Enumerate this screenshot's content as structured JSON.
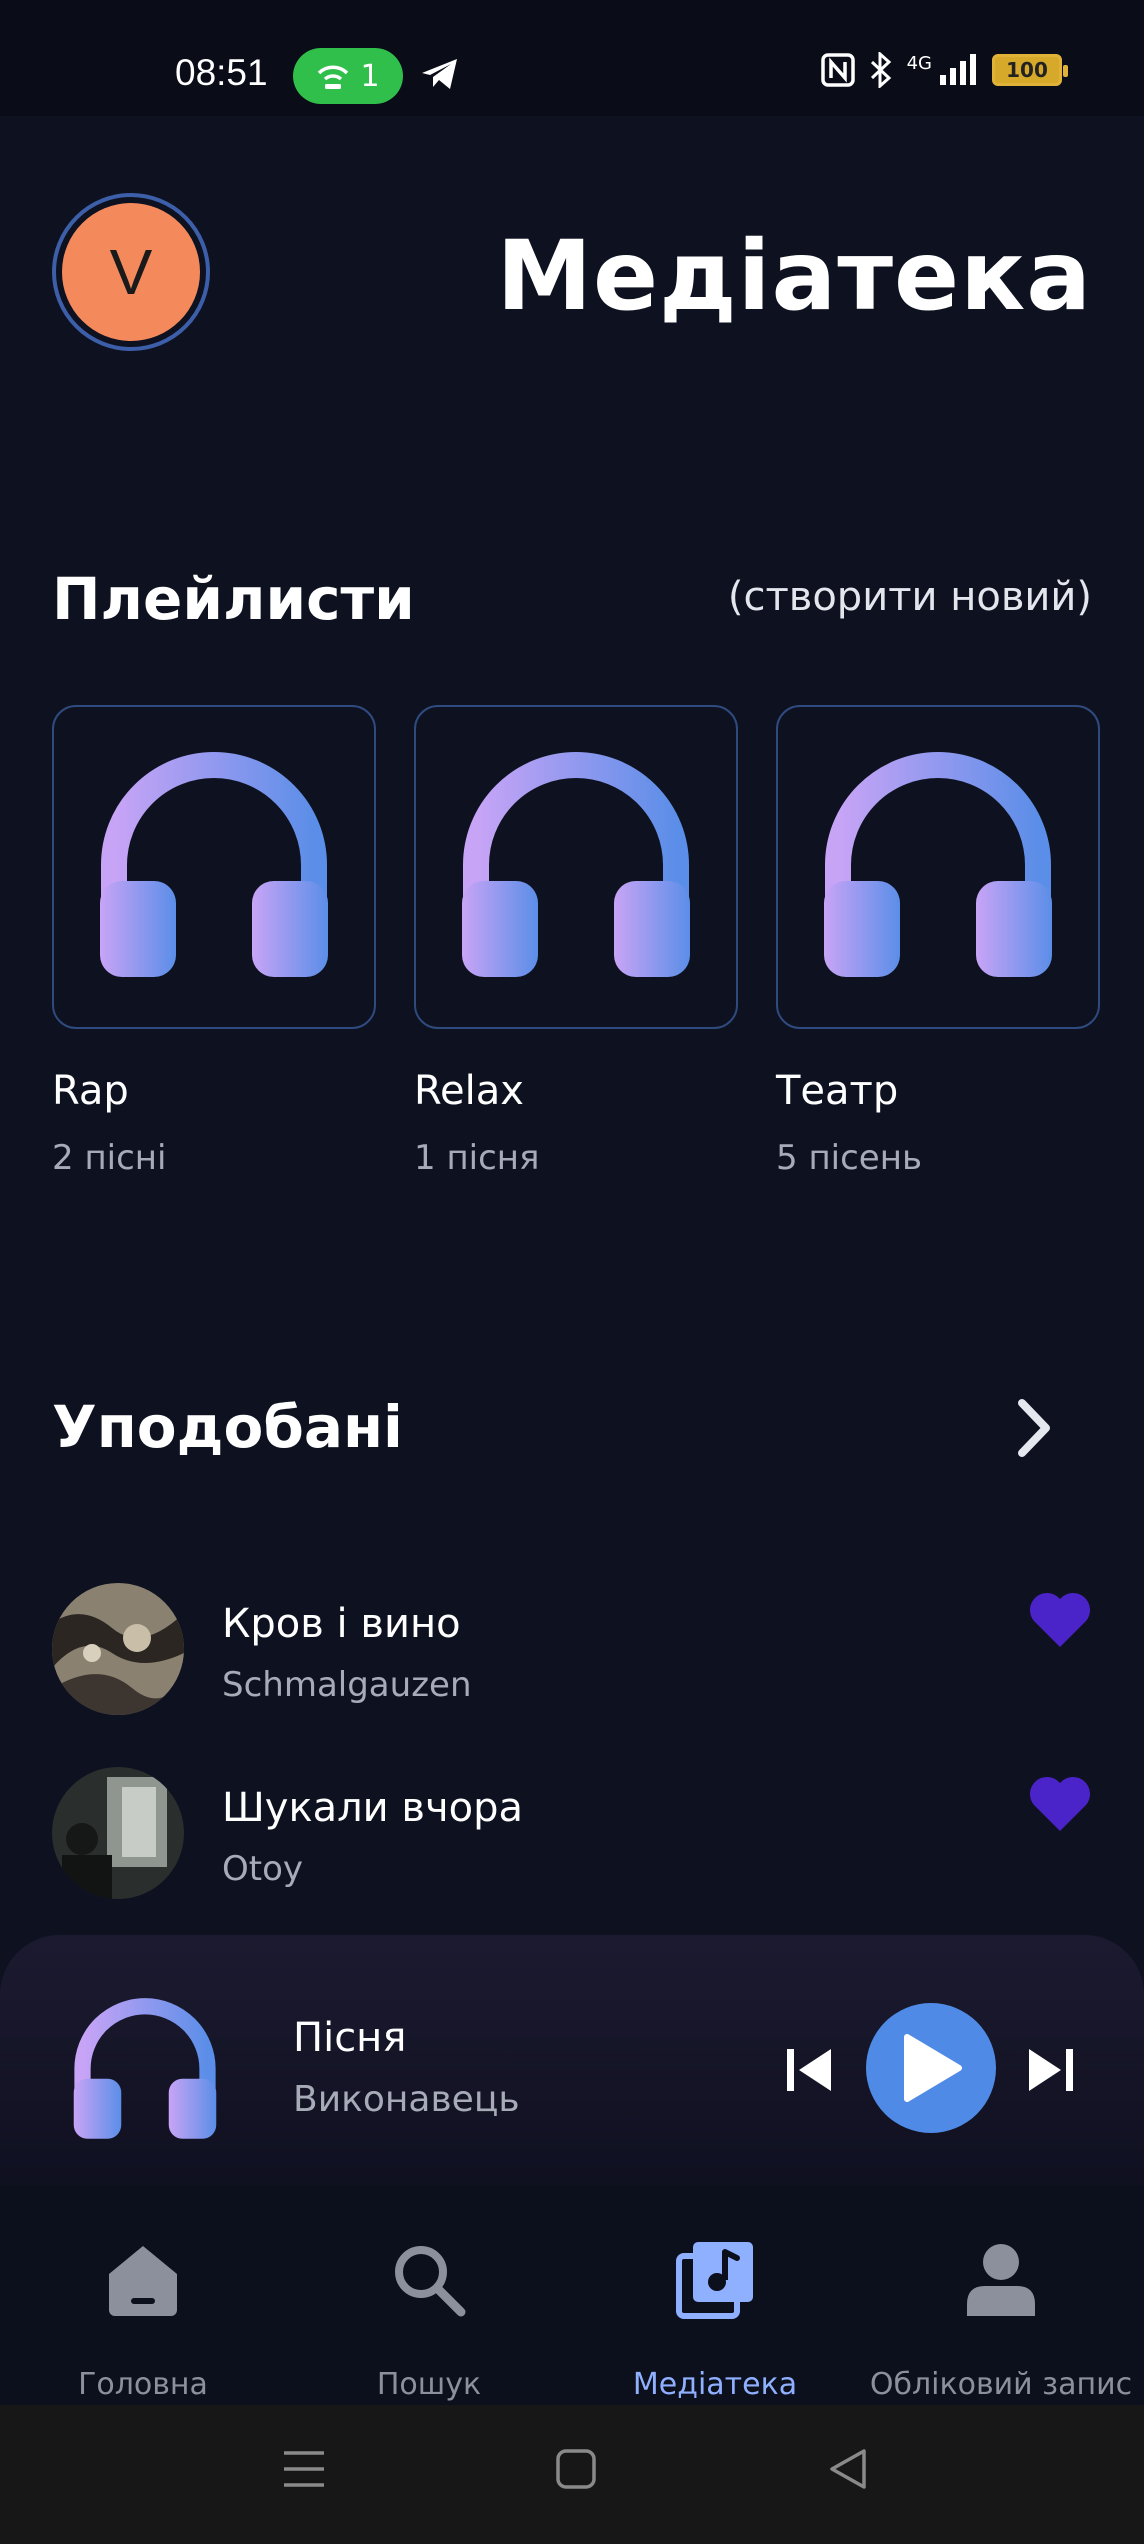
{
  "status_bar": {
    "time": "08:51",
    "hotspot_count": "1",
    "network": "4G",
    "battery": "100"
  },
  "header": {
    "avatar_letter": "V",
    "title": "Медіатека"
  },
  "playlists": {
    "title": "Плейлисти",
    "create_label": "(створити новий)",
    "items": [
      {
        "name": "Rap",
        "count": "2 пісні"
      },
      {
        "name": "Relax",
        "count": "1 пісня"
      },
      {
        "name": "Театр",
        "count": "5 пісень"
      }
    ]
  },
  "favorites": {
    "title": "Уподобані",
    "songs": [
      {
        "title": "Кров і вино",
        "artist": "Schmalgauzen"
      },
      {
        "title": "Шукали вчора",
        "artist": "Otoy"
      }
    ]
  },
  "player": {
    "song": "Пісня",
    "artist": "Виконавець"
  },
  "nav": {
    "items": [
      {
        "label": "Головна",
        "icon": "home-icon"
      },
      {
        "label": "Пошук",
        "icon": "search-icon"
      },
      {
        "label": "Медіатека",
        "icon": "library-icon",
        "active": true
      },
      {
        "label": "Обліковий запис",
        "icon": "account-icon"
      }
    ]
  },
  "colors": {
    "background": "#0e1220",
    "accent": "#4f8be6",
    "heart": "#4a23c9",
    "active_nav": "#8fb0ff"
  }
}
